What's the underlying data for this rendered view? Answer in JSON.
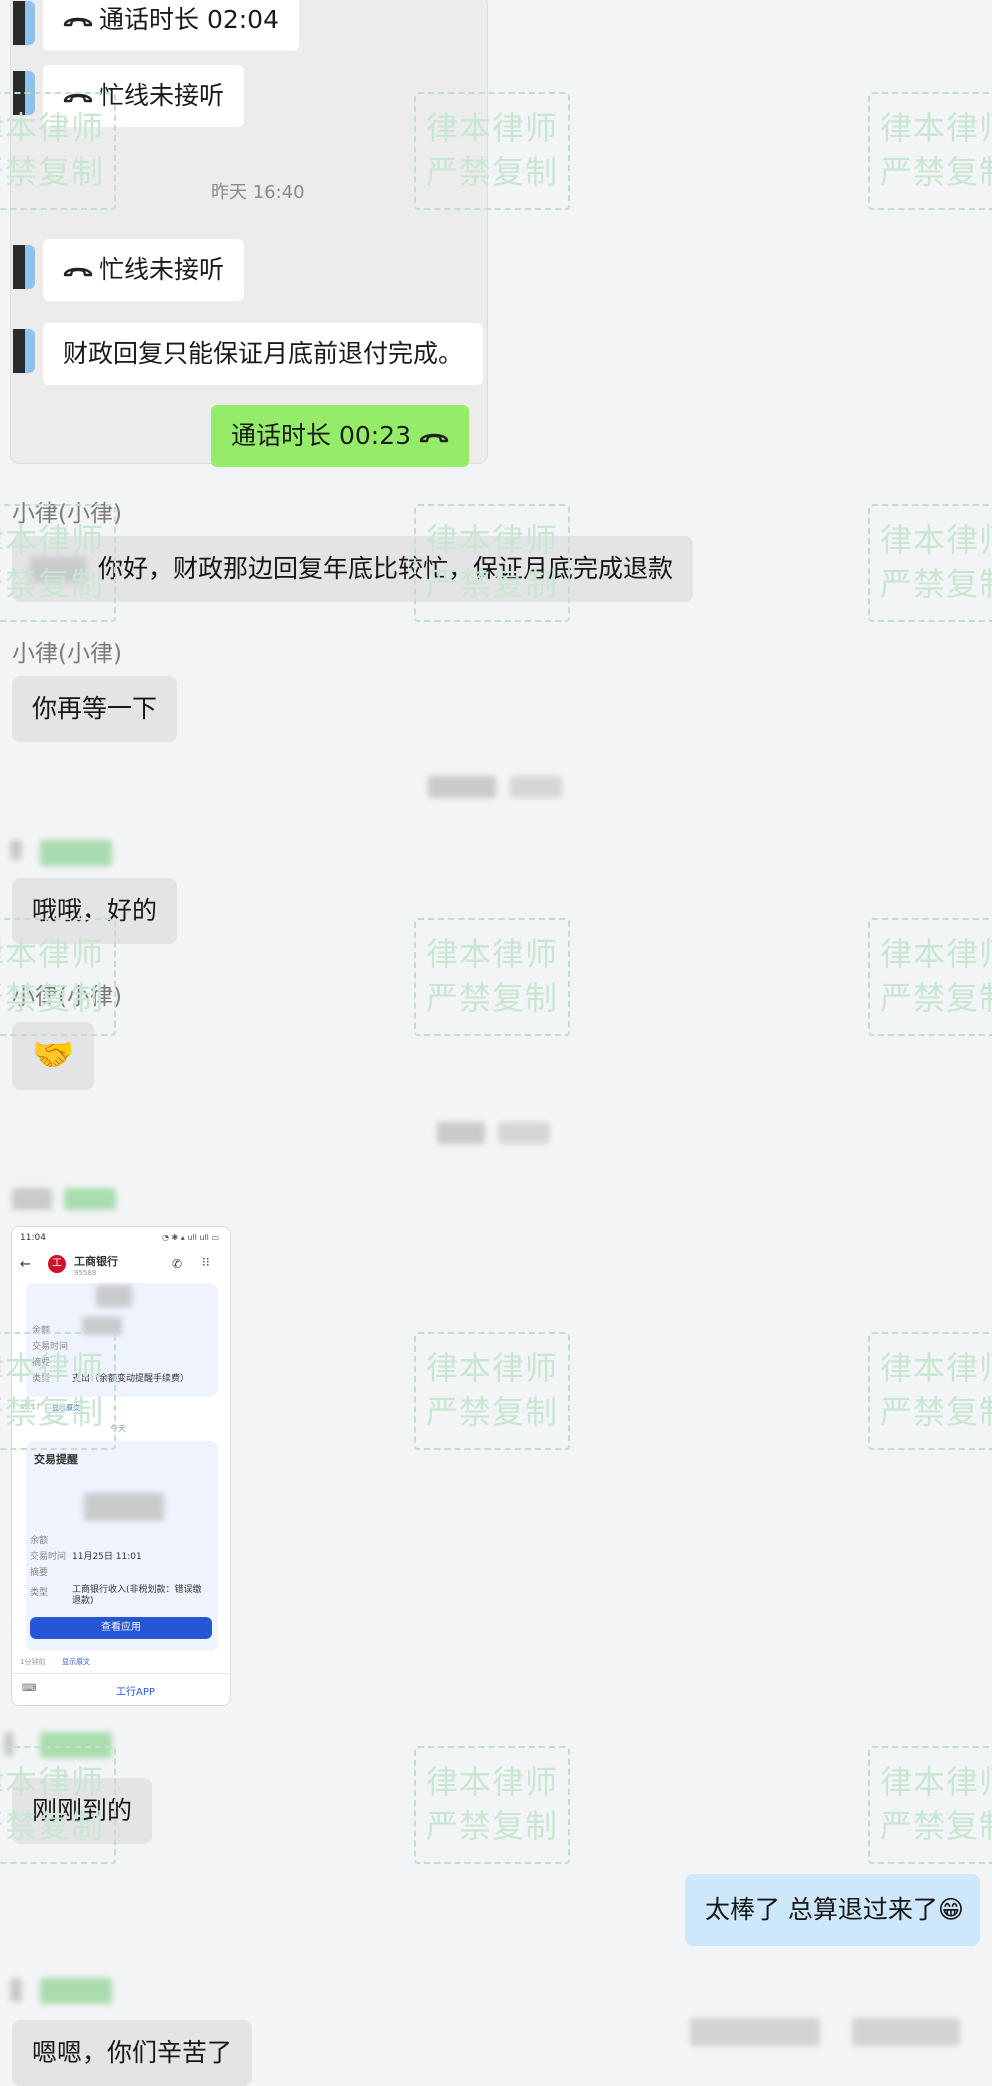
{
  "quoted_record": {
    "call_duration_1": "通话时长 02:04",
    "busy_1": "忙线未接听",
    "time_divider": "昨天 16:40",
    "busy_2": "忙线未接听",
    "finance_msg": "财政回复只能保证月底前退付完成。",
    "call_duration_2": "通话时长 00:23"
  },
  "messages": [
    {
      "sender": "小律(小律)",
      "text": "你好，财政那边回复年底比较忙，保证月底完成退款"
    },
    {
      "sender": "小律(小律)",
      "text": "你再等一下"
    },
    {
      "sender": "",
      "text": "哦哦，好的"
    },
    {
      "sender": "小律(小律)",
      "text": "🤝"
    },
    {
      "sender": "",
      "text": "刚刚到的"
    },
    {
      "sender": "me",
      "text": "太棒了 总算退过来了😁"
    },
    {
      "sender": "",
      "text": "嗯嗯，你们辛苦了"
    }
  ],
  "bank_screenshot": {
    "status_time": "11:04",
    "bank_name": "工商银行",
    "bank_number": "95588",
    "label_balance": "余额",
    "label_tx_time": "交易时间",
    "label_remark": "摘要",
    "label_type": "类型",
    "type_value_1": "支出（余额变动提醒手续费）",
    "link_text": "显示原文",
    "day_label": "今天",
    "card_title": "交易提醒",
    "tx_time_value": "11月25日 11:01",
    "type_value_2": "工商银行收入(非税划款：错误缴退款)",
    "view_button": "查看应用",
    "footer_app": "工行APP"
  },
  "watermark": {
    "line1": "律本律师",
    "line2": "严禁复制"
  },
  "colors": {
    "my_bubble": "#cde7fb",
    "their_bubble": "#e4e4e6",
    "call_bubble": "#95ec69"
  }
}
